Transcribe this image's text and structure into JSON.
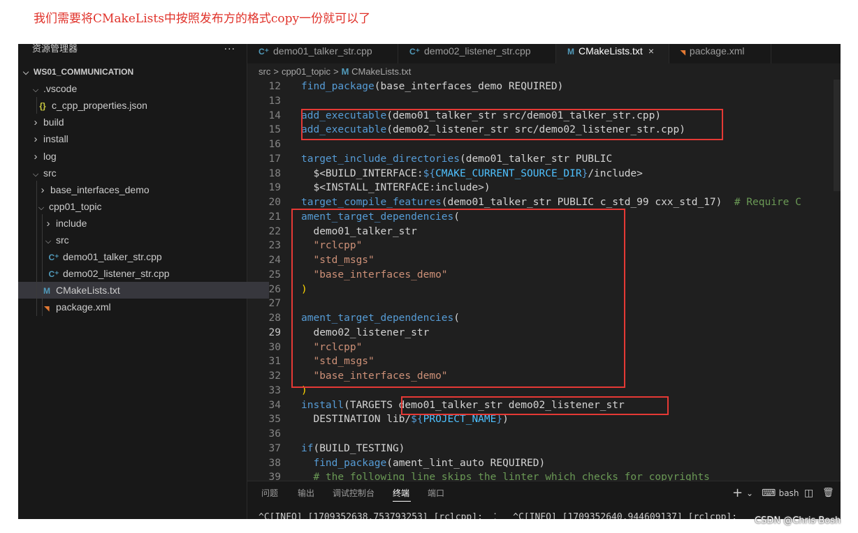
{
  "caption": "我们需要将CMakeLists中按照发布方的格式copy一份就可以了",
  "sidebar": {
    "title": "资源管理器",
    "more": "···",
    "items": [
      {
        "label": "WS01_COMMUNICATION",
        "arrow": "expanded",
        "icon": ""
      },
      {
        "label": ".vscode",
        "arrow": "expanded",
        "icon": ""
      },
      {
        "label": "c_cpp_properties.json",
        "arrow": "",
        "icon": "{}"
      },
      {
        "label": "build",
        "arrow": "collapsed",
        "icon": ""
      },
      {
        "label": "install",
        "arrow": "collapsed",
        "icon": ""
      },
      {
        "label": "log",
        "arrow": "collapsed",
        "icon": ""
      },
      {
        "label": "src",
        "arrow": "expanded",
        "icon": ""
      },
      {
        "label": "base_interfaces_demo",
        "arrow": "collapsed",
        "icon": ""
      },
      {
        "label": "cpp01_topic",
        "arrow": "expanded",
        "icon": ""
      },
      {
        "label": "include",
        "arrow": "collapsed",
        "icon": ""
      },
      {
        "label": "src",
        "arrow": "expanded",
        "icon": ""
      },
      {
        "label": "demo01_talker_str.cpp",
        "arrow": "",
        "icon": "C+"
      },
      {
        "label": "demo02_listener_str.cpp",
        "arrow": "",
        "icon": "C+"
      },
      {
        "label": "CMakeLists.txt",
        "arrow": "",
        "icon": "M"
      },
      {
        "label": "package.xml",
        "arrow": "",
        "icon": "rss"
      }
    ]
  },
  "tabs": [
    {
      "label": "demo01_talker_str.cpp",
      "icon": "C+"
    },
    {
      "label": "demo02_listener_str.cpp",
      "icon": "C+"
    },
    {
      "label": "CMakeLists.txt",
      "icon": "M",
      "close": "×"
    },
    {
      "label": "package.xml",
      "icon": "rss"
    }
  ],
  "breadcrumb": {
    "parts": [
      "src",
      "cpp01_topic",
      "CMakeLists.txt"
    ],
    "separator": ">"
  },
  "code": {
    "current_line": "29",
    "lines": [
      {
        "n": "12",
        "segs": [
          {
            "t": "find_package",
            "c": "kw"
          },
          {
            "t": "(base_interfaces_demo REQUIRED)"
          }
        ]
      },
      {
        "n": "13",
        "segs": []
      },
      {
        "n": "14",
        "segs": [
          {
            "t": "add_executable",
            "c": "kw"
          },
          {
            "t": "(demo01_talker_str src/demo01_talker_str.cpp)"
          }
        ]
      },
      {
        "n": "15",
        "segs": [
          {
            "t": "add_executable",
            "c": "kw"
          },
          {
            "t": "(demo02_listener_str src/demo02_listener_str.cpp)"
          }
        ]
      },
      {
        "n": "16",
        "segs": []
      },
      {
        "n": "17",
        "segs": [
          {
            "t": "target_include_directories",
            "c": "kw"
          },
          {
            "t": "(demo01_talker_str PUBLIC"
          }
        ]
      },
      {
        "n": "18",
        "segs": [
          {
            "t": "  $<BUILD_INTERFACE:"
          },
          {
            "t": "${",
            "c": "kw"
          },
          {
            "t": "CMAKE_CURRENT_SOURCE_DIR",
            "c": "var"
          },
          {
            "t": "}",
            "c": "kw"
          },
          {
            "t": "/include>"
          }
        ]
      },
      {
        "n": "19",
        "segs": [
          {
            "t": "  $<INSTALL_INTERFACE:include>)"
          }
        ]
      },
      {
        "n": "20",
        "segs": [
          {
            "t": "target_compile_features",
            "c": "kw"
          },
          {
            "t": "(demo01_talker_str PUBLIC c_std_99 cxx_std_17)  "
          },
          {
            "t": "# Require C",
            "c": "cmt"
          }
        ]
      },
      {
        "n": "21",
        "segs": [
          {
            "t": "ament_target_dependencies",
            "c": "kw"
          },
          {
            "t": "("
          }
        ]
      },
      {
        "n": "22",
        "segs": [
          {
            "t": "  demo01_talker_str"
          }
        ]
      },
      {
        "n": "23",
        "segs": [
          {
            "t": "  "
          },
          {
            "t": "\"rclcpp\"",
            "c": "str"
          }
        ]
      },
      {
        "n": "24",
        "segs": [
          {
            "t": "  "
          },
          {
            "t": "\"std_msgs\"",
            "c": "str"
          }
        ]
      },
      {
        "n": "25",
        "segs": [
          {
            "t": "  "
          },
          {
            "t": "\"base_interfaces_demo\"",
            "c": "str"
          }
        ]
      },
      {
        "n": "26",
        "segs": [
          {
            "t": ")",
            "c": "par"
          }
        ]
      },
      {
        "n": "27",
        "segs": []
      },
      {
        "n": "28",
        "segs": [
          {
            "t": "ament_target_dependencies",
            "c": "kw"
          },
          {
            "t": "("
          }
        ]
      },
      {
        "n": "29",
        "segs": [
          {
            "t": "  demo02_listener_str"
          }
        ]
      },
      {
        "n": "30",
        "segs": [
          {
            "t": "  "
          },
          {
            "t": "\"rclcpp\"",
            "c": "str"
          }
        ]
      },
      {
        "n": "31",
        "segs": [
          {
            "t": "  "
          },
          {
            "t": "\"std_msgs\"",
            "c": "str"
          }
        ]
      },
      {
        "n": "32",
        "segs": [
          {
            "t": "  "
          },
          {
            "t": "\"base_interfaces_demo\"",
            "c": "str"
          }
        ]
      },
      {
        "n": "33",
        "segs": [
          {
            "t": ")",
            "c": "par"
          }
        ]
      },
      {
        "n": "34",
        "segs": [
          {
            "t": "install",
            "c": "kw"
          },
          {
            "t": "(TARGETS demo01_talker_str demo02_listener_str"
          }
        ]
      },
      {
        "n": "35",
        "segs": [
          {
            "t": "  DESTINATION lib/"
          },
          {
            "t": "${",
            "c": "kw"
          },
          {
            "t": "PROJECT_NAME",
            "c": "var"
          },
          {
            "t": "}",
            "c": "kw"
          },
          {
            "t": ")"
          }
        ]
      },
      {
        "n": "36",
        "segs": []
      },
      {
        "n": "37",
        "segs": [
          {
            "t": "if",
            "c": "kw"
          },
          {
            "t": "(BUILD_TESTING)"
          }
        ]
      },
      {
        "n": "38",
        "segs": [
          {
            "t": "  "
          },
          {
            "t": "find_package",
            "c": "kw"
          },
          {
            "t": "(ament_lint_auto REQUIRED)"
          }
        ]
      },
      {
        "n": "39",
        "segs": [
          {
            "t": "  "
          },
          {
            "t": "# the following line skips the linter which checks for copyrights",
            "c": "cmt"
          }
        ]
      }
    ]
  },
  "panel": {
    "tabs": [
      "问题",
      "输出",
      "调试控制台",
      "终端",
      "端口"
    ],
    "active_tab": "终端",
    "controls": {
      "add": "+",
      "dropdown": "⌄",
      "shell": "bash",
      "split": "◫",
      "trash": "🗑"
    },
    "terminal_text": "^C[INFO] [1709352638.753793253] [rclcpp]:  ⁚   ^C[INFO] [1709352640.944609137] [rclcpp]:"
  },
  "watermark": "CSDN @Chris·Bosh",
  "colors": {
    "annotation_red": "#e53935",
    "caption_red": "#e0322a",
    "editor_bg": "#1f1f1f",
    "keyword": "#569cd6",
    "string": "#ce9178",
    "comment": "#6a9955"
  }
}
